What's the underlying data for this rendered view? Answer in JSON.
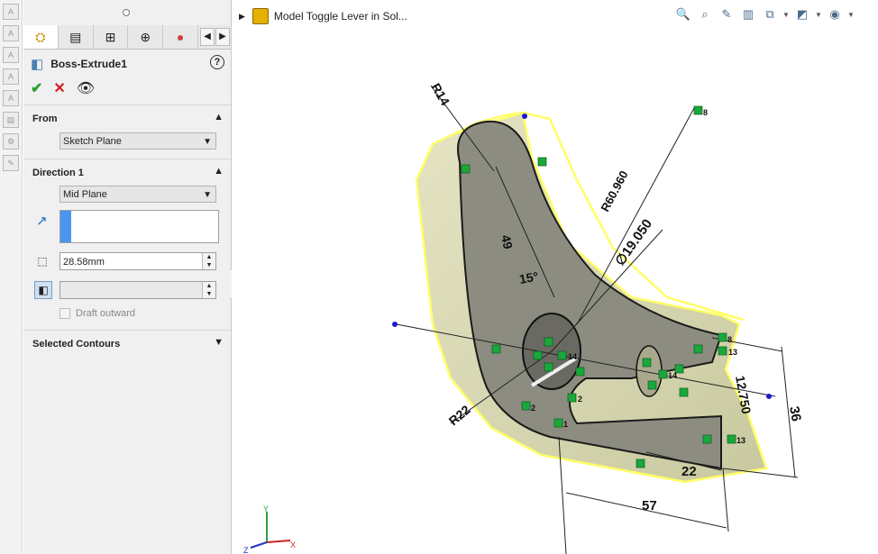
{
  "feature": {
    "title": "Boss-Extrude1",
    "help": "?"
  },
  "confirm": {
    "ok": "✔",
    "cancel": "✕",
    "preview": "👁"
  },
  "from": {
    "title": "From",
    "value": "Sketch Plane"
  },
  "direction1": {
    "title": "Direction 1",
    "end_condition": "Mid Plane",
    "depth": "28.58mm",
    "draft_label": "Draft outward"
  },
  "selected_contours": {
    "title": "Selected Contours"
  },
  "viewport": {
    "document_title": "Model Toggle Lever in Sol..."
  },
  "dimensions": {
    "r14": "R14",
    "r60": "R60.960",
    "d49": "49",
    "d19": "∅19.050",
    "d15": "15°",
    "r22": "R22",
    "d12": "12.750",
    "d36": "36",
    "d22": "22",
    "d57": "57"
  },
  "relations": {
    "r8a": "8",
    "r8b": "8",
    "r13a": "13",
    "r13b": "13",
    "r14a": "14",
    "r14b": "14",
    "r2a": "2",
    "r2b": "2",
    "r1": "1"
  },
  "triad": {
    "x": "X",
    "y": "Y",
    "z": "Z"
  },
  "colors": {
    "accent": "#4a96f0",
    "model_edge": "#ffff66",
    "model_face": "#d9d9a8",
    "relation": "#1aa83c"
  }
}
